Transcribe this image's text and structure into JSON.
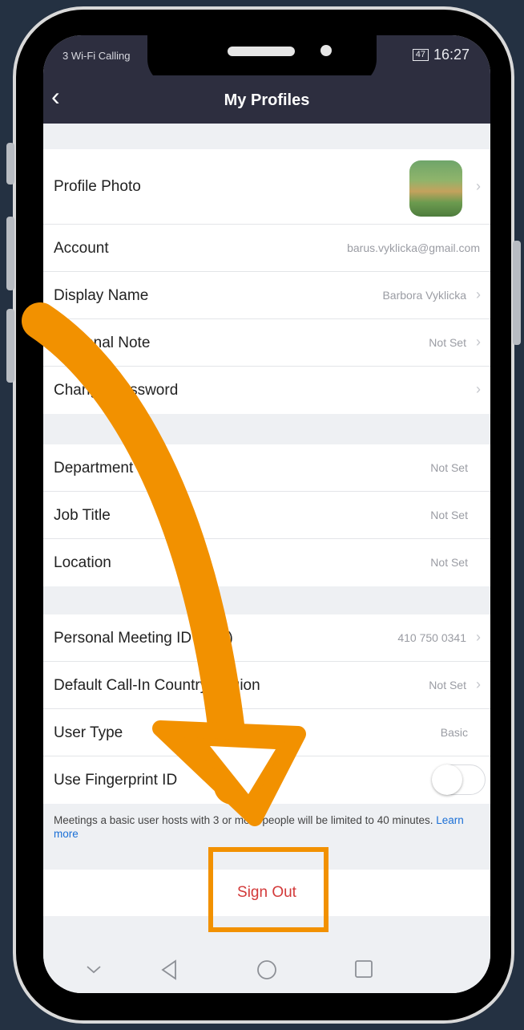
{
  "status_bar": {
    "carrier": "3 Wi-Fi Calling",
    "battery": "47",
    "time": "16:27"
  },
  "nav": {
    "back_glyph": "‹",
    "title": "My Profiles"
  },
  "sections": {
    "profile": [
      {
        "label": "Profile Photo",
        "value": ""
      },
      {
        "label": "Account",
        "value": "barus.vyklicka@gmail.com"
      },
      {
        "label": "Display Name",
        "value": "Barbora Vyklicka"
      },
      {
        "label": "Personal Note",
        "value": "Not Set"
      },
      {
        "label": "Change Password",
        "value": ""
      }
    ],
    "work": [
      {
        "label": "Department",
        "value": "Not Set"
      },
      {
        "label": "Job Title",
        "value": "Not Set"
      },
      {
        "label": "Location",
        "value": "Not Set"
      }
    ],
    "meeting": [
      {
        "label": "Personal Meeting ID (PMI)",
        "value": "410 750 0341"
      },
      {
        "label": "Default Call-In Country/Region",
        "value": "Not Set"
      },
      {
        "label": "User Type",
        "value": "Basic"
      },
      {
        "label": "Use Fingerprint ID",
        "toggle": false
      }
    ]
  },
  "footnote": {
    "text": "Meetings a basic user hosts with 3 or more people will be limited to 40 minutes.",
    "link": "Learn more"
  },
  "sign_out": "Sign Out",
  "chevron_glyph": "›",
  "system_nav": {
    "icons": [
      "chevron-down-icon",
      "back-triangle-icon",
      "home-circle-icon",
      "recents-square-icon"
    ]
  },
  "colors": {
    "accent_orange": "#f29100",
    "header": "#2d2e3f",
    "sign_out": "#d33a3a",
    "link": "#1a6fd6",
    "background": "#243142"
  }
}
